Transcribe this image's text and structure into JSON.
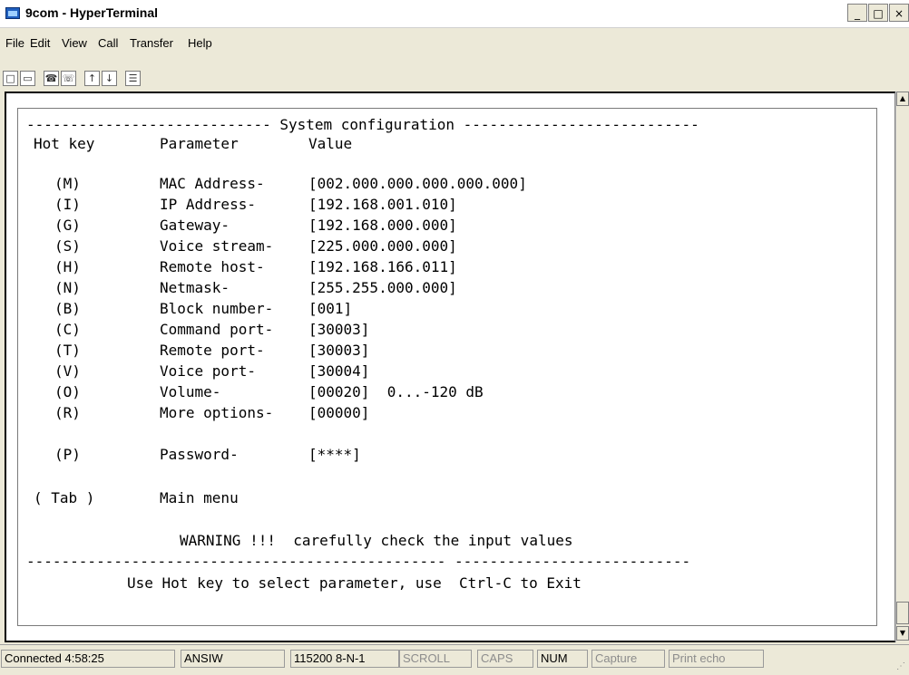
{
  "window": {
    "title": "9com - HyperTerminal",
    "minimize": "_",
    "maximize": "□",
    "close": "×"
  },
  "menu": [
    "File",
    "Edit",
    "View",
    "Call",
    "Transfer",
    "Help"
  ],
  "toolbar": [
    "new-icon",
    "open-icon",
    "call-icon",
    "disconnect-icon",
    "send-icon",
    "receive-icon",
    "properties-icon"
  ],
  "terminal": {
    "header_line": "---------------------------- System configuration ---------------------------",
    "columns": {
      "hotkey": "Hot key",
      "parameter": "Parameter",
      "value": "Value"
    },
    "rows": [
      {
        "key": "(M)",
        "param": "MAC Address-",
        "value": "[002.000.000.000.000.000]"
      },
      {
        "key": "(I)",
        "param": "IP Address-",
        "value": "[192.168.001.010]"
      },
      {
        "key": "(G)",
        "param": "Gateway-",
        "value": "[192.168.000.000]"
      },
      {
        "key": "(S)",
        "param": "Voice stream-",
        "value": "[225.000.000.000]"
      },
      {
        "key": "(H)",
        "param": "Remote host-",
        "value": "[192.168.166.011]"
      },
      {
        "key": "(N)",
        "param": "Netmask-",
        "value": "[255.255.000.000]"
      },
      {
        "key": "(B)",
        "param": "Block number-",
        "value": "[001]"
      },
      {
        "key": "(C)",
        "param": "Command port-",
        "value": "[30003]"
      },
      {
        "key": "(T)",
        "param": "Remote port-",
        "value": "[30003]"
      },
      {
        "key": "(V)",
        "param": "Voice port-",
        "value": "[30004]"
      },
      {
        "key": "(O)",
        "param": "Volume-",
        "value": "[00020]  0...-120 dB"
      },
      {
        "key": "(R)",
        "param": "More options-",
        "value": "[00000]"
      }
    ],
    "password": {
      "key": "(P)",
      "param": "Password-",
      "value": "[****]"
    },
    "tab_row": {
      "key": "( Tab )",
      "param": "Main menu"
    },
    "warning": "WARNING !!!  carefully check the input values",
    "bottom_line": "------------------------------------------------ ---------------------------",
    "hint": "Use Hot key to select parameter, use  Ctrl-C to Exit"
  },
  "status": {
    "connected": "Connected 4:58:25",
    "emulation": "ANSIW",
    "port": "115200 8-N-1",
    "scroll": "SCROLL",
    "caps": "CAPS",
    "num": "NUM",
    "capture": "Capture",
    "print_echo": "Print echo"
  }
}
